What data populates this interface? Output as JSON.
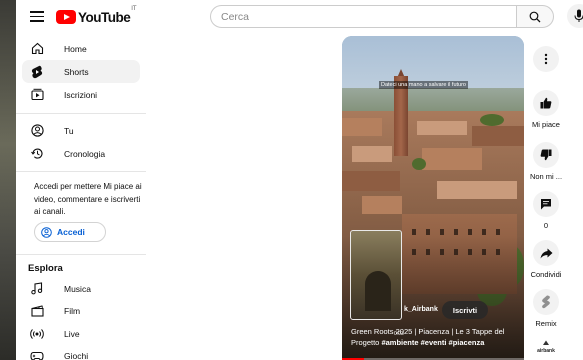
{
  "header": {
    "logo_text": "YouTube",
    "logo_country": "IT",
    "search_placeholder": "Cerca"
  },
  "sidebar": {
    "items": [
      {
        "label": "Home",
        "icon": "home-icon",
        "active": false
      },
      {
        "label": "Shorts",
        "icon": "shorts-icon",
        "active": true
      },
      {
        "label": "Iscrizioni",
        "icon": "subscriptions-icon",
        "active": false
      },
      {
        "label": "Tu",
        "icon": "you-icon",
        "active": false
      },
      {
        "label": "Cronologia",
        "icon": "history-icon",
        "active": false
      }
    ],
    "signin_prompt": "Accedi per mettere Mi piace ai video, commentare e iscriverti ai canali.",
    "signin_button": "Accedi",
    "explore_title": "Esplora",
    "explore_items": [
      {
        "label": "Musica",
        "icon": "music-icon"
      },
      {
        "label": "Film",
        "icon": "film-icon"
      },
      {
        "label": "Live",
        "icon": "live-icon"
      },
      {
        "label": "Giochi",
        "icon": "gaming-icon"
      }
    ]
  },
  "video": {
    "overlay_caption": "Dateci una mano a salvare il futuro",
    "channel": "k_Airbank",
    "subscribe_label": "Iscrivti",
    "timestamp": "0:03",
    "title_line": "Green Roots 2025 | Piacenza | Le 3 Tappe del Progetto ",
    "hashtags": "#ambiente #eventi #piacenza",
    "progress": 0.12
  },
  "actions": {
    "more_icon": "more-vert-icon",
    "like_label": "Mi piace",
    "dislike_label": "Non mi ...",
    "comments_count": "0",
    "share_label": "Condividi",
    "remix_label": "Remix",
    "channel_avatar_text": "airbank"
  }
}
